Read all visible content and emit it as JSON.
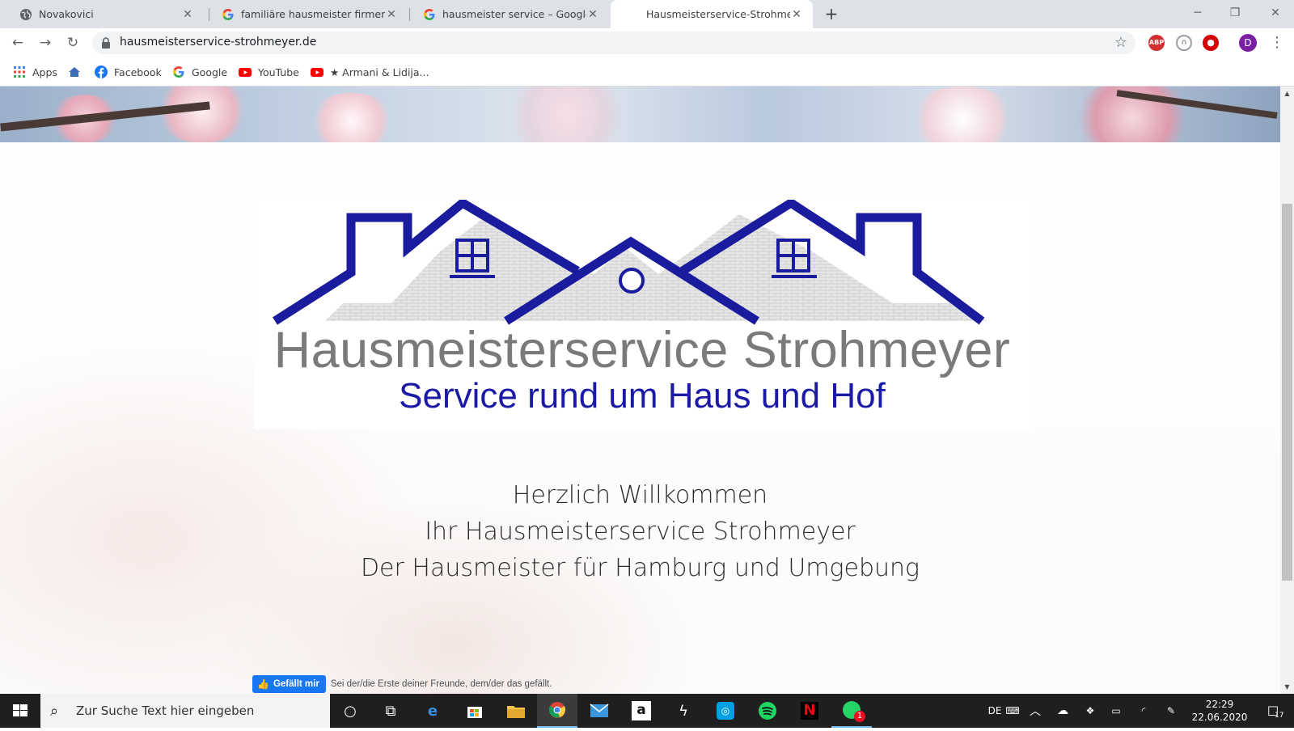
{
  "tabs": [
    {
      "title": "Novakovici",
      "icon": "globe-icon"
    },
    {
      "title": "familiäre hausmeister firmen – Google-Suche",
      "icon": "google-icon"
    },
    {
      "title": "hausmeister service – Google-Suche",
      "icon": "google-icon"
    },
    {
      "title": "Hausmeisterservice-Strohmeyer",
      "icon": "none"
    }
  ],
  "active_tab": 3,
  "address_bar": {
    "url": "hausmeisterservice-strohmeyer.de"
  },
  "profile_initial": "D",
  "extensions": [
    "ABP",
    "headphones",
    "shield"
  ],
  "bookmarks": [
    {
      "label": "Apps",
      "icon": "apps-grid-icon"
    },
    {
      "label": "",
      "icon": "home-icon"
    },
    {
      "label": "Facebook",
      "icon": "facebook-icon"
    },
    {
      "label": "Google",
      "icon": "google-icon"
    },
    {
      "label": "YouTube",
      "icon": "youtube-icon"
    },
    {
      "label": "★ Armani & Lidija...",
      "icon": "youtube-icon"
    }
  ],
  "page": {
    "brand_name": "Hausmeisterservice Strohmeyer",
    "tagline": "Service rund um Haus und Hof",
    "welcome_lines": [
      "Herzlich Willkommen",
      "Ihr Hausmeisterservice Strohmeyer",
      "Der Hausmeister für Hamburg und Umgebung"
    ],
    "fb_like_label": "Gefällt mir",
    "fb_like_text": "Sei der/die Erste deiner Freunde, dem/der das gefällt."
  },
  "taskbar": {
    "search_placeholder": "Zur Suche Text hier eingeben",
    "apps": [
      "cortana",
      "task-view",
      "edge",
      "store",
      "explorer",
      "chrome",
      "mail",
      "amazon",
      "lightning",
      "instagram",
      "spotify",
      "netflix",
      "whatsapp"
    ],
    "active_app": "chrome",
    "language": "DE",
    "time": "22:29",
    "date": "22.06.2020",
    "notifications": "17",
    "whatsapp_badge": "1"
  },
  "colors": {
    "brand_gray": "#7a7a7a",
    "brand_blue": "#1a1aa6",
    "roof_blue": "#1b1b9e",
    "facebook_blue": "#1877f2"
  }
}
